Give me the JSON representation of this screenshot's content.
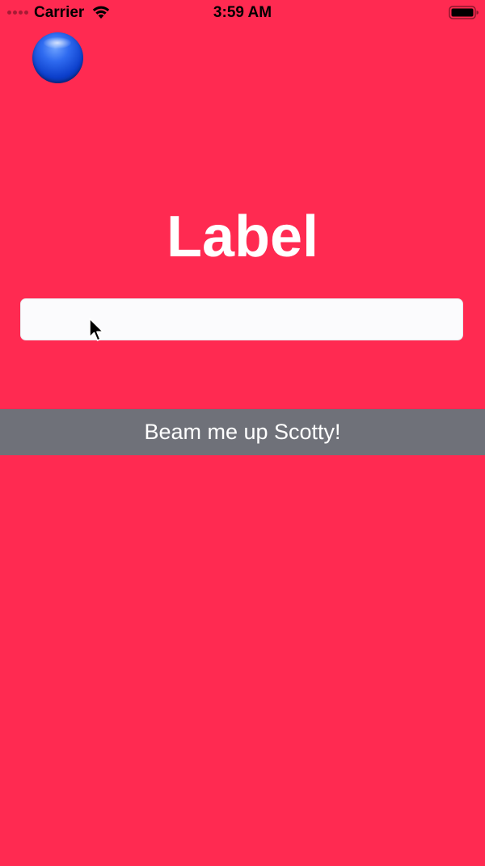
{
  "status_bar": {
    "carrier": "Carrier",
    "time": "3:59 AM",
    "icons": [
      "signal-dots-icon",
      "wifi-icon",
      "battery-icon"
    ]
  },
  "ball": {
    "icon": "blue-ball-icon",
    "color": "#1A4FE0"
  },
  "main": {
    "title": "Label",
    "text_field": {
      "value": "",
      "placeholder": ""
    },
    "action_button_label": "Beam me up Scotty!"
  },
  "colors": {
    "background": "#FF2A51",
    "button_background": "#6F7179",
    "text_field_background": "#FBFBFD",
    "title_text": "#FFFFFF"
  }
}
